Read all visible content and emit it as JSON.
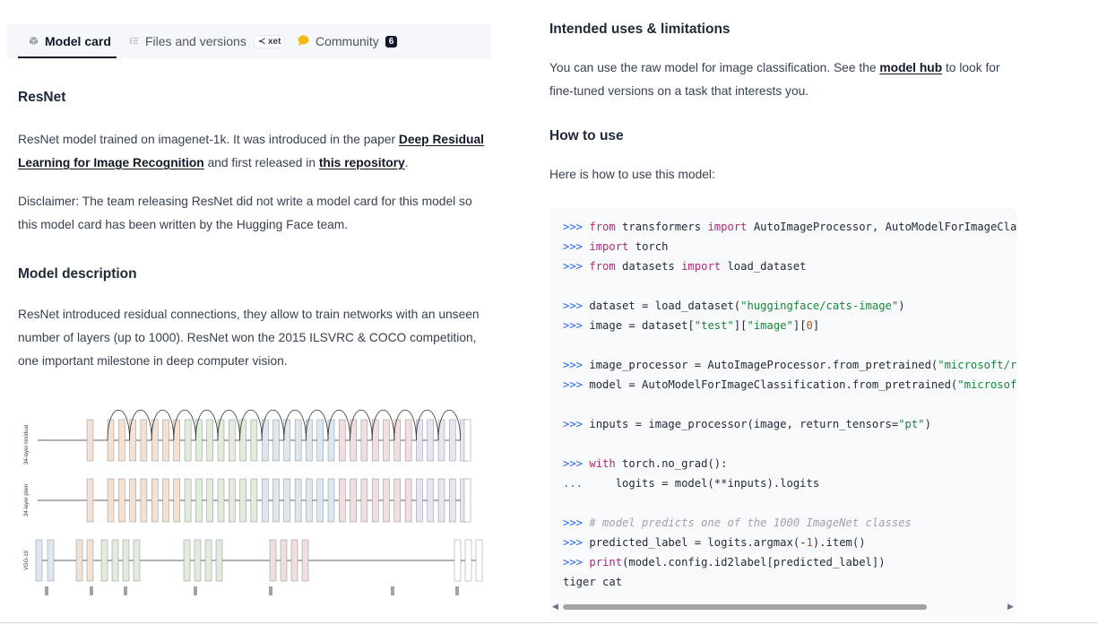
{
  "tabs": {
    "model_card": "Model card",
    "files": "Files and versions",
    "xet": "xet",
    "community": "Community",
    "community_count": "6"
  },
  "left": {
    "title": "ResNet",
    "intro_1": "ResNet model trained on imagenet-1k. It was introduced in the paper ",
    "intro_link": "Deep Residual Learning for Image Recognition",
    "intro_2": " and first released in ",
    "intro_link2": "this repository",
    "intro_3": ".",
    "disclaimer": "Disclaimer: The team releasing ResNet did not write a model card for this model so this model card has been written by the Hugging Face team.",
    "desc_heading": "Model description",
    "desc": "ResNet introduced residual connections, they allow to train networks with an unseen number of layers (up to 1000). ResNet won the 2015 ILSVRC & COCO competition, one important milestone in deep computer vision.",
    "diagram_labels": [
      "34-layer residual",
      "34-layer plain",
      "VGG-19"
    ]
  },
  "right": {
    "uses_heading": "Intended uses & limitations",
    "uses_1": "You can use the raw model for image classification. See the ",
    "uses_link": "model hub",
    "uses_2": " to look for fine-tuned versions on a task that interests you.",
    "how_heading": "How to use",
    "how_text": "Here is how to use this model:"
  },
  "code": {
    "lines": [
      ">>> from transformers import AutoImageProcessor, AutoModelForImageCla",
      ">>> import torch",
      ">>> from datasets import load_dataset",
      "",
      ">>> dataset = load_dataset(\"huggingface/cats-image\")",
      ">>> image = dataset[\"test\"][\"image\"][0]",
      "",
      ">>> image_processor = AutoImageProcessor.from_pretrained(\"microsoft/r",
      ">>> model = AutoModelForImageClassification.from_pretrained(\"microsof",
      "",
      ">>> inputs = image_processor(image, return_tensors=\"pt\")",
      "",
      ">>> with torch.no_grad():",
      "...     logits = model(**inputs).logits",
      "",
      ">>> # model predicts one of the 1000 ImageNet classes",
      ">>> predicted_label = logits.argmax(-1).item()",
      ">>> print(model.config.id2label[predicted_label])",
      "tiger cat"
    ]
  },
  "icons": {
    "model_card": "cube-icon",
    "files": "files-icon",
    "community": "chat-bubble-icon"
  },
  "colors": {
    "tab_bg": "#f6f7fb",
    "code_bg": "#f8f9fb",
    "prompt": "#2563eb",
    "keyword": "#b5267a",
    "string": "#16873a"
  }
}
